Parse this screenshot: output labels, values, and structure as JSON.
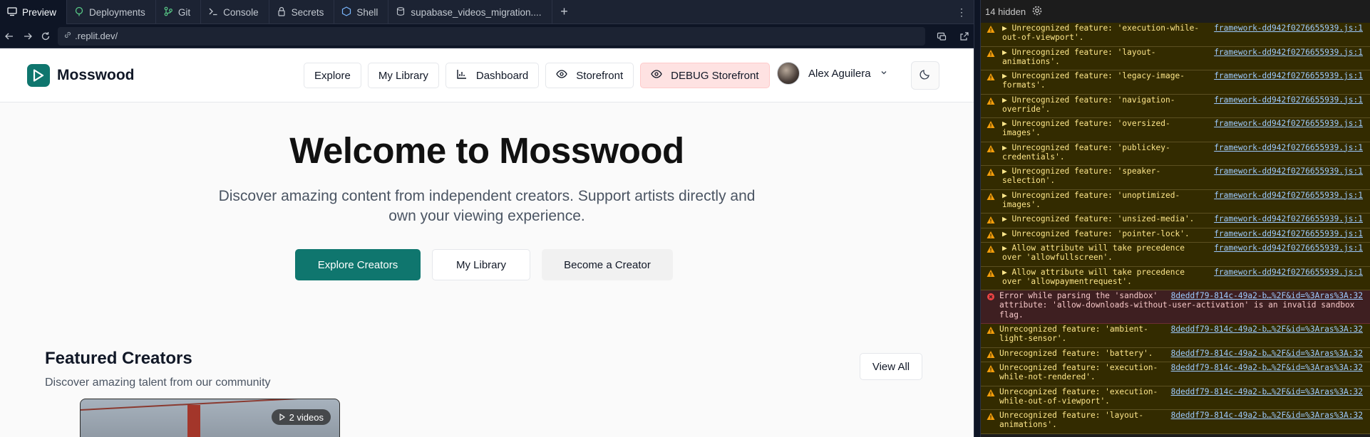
{
  "ide": {
    "tabs": [
      {
        "label": "Preview",
        "icon": "preview-icon",
        "active": true
      },
      {
        "label": "Deployments",
        "icon": "deployments-icon"
      },
      {
        "label": "Git",
        "icon": "git-icon"
      },
      {
        "label": "Console",
        "icon": "console-icon"
      },
      {
        "label": "Secrets",
        "icon": "lock-icon"
      },
      {
        "label": "Shell",
        "icon": "shell-icon"
      },
      {
        "label": "supabase_videos_migration....",
        "icon": "file-icon"
      }
    ],
    "add_tab": "+",
    "more": "⋮",
    "url": ".replit.dev/"
  },
  "site": {
    "brand": "Mosswood",
    "nav": [
      "Explore",
      "My Library",
      "Dashboard",
      "Storefront",
      "DEBUG Storefront"
    ],
    "user_name": "Alex Aguilera",
    "hero_title": "Welcome to Mosswood",
    "hero_subtitle": "Discover amazing content from independent creators. Support artists directly and own your viewing experience.",
    "cta": {
      "primary": "Explore Creators",
      "secondary": "My Library",
      "tertiary": "Become a Creator"
    },
    "featured_title": "Featured Creators",
    "featured_subtitle": "Discover amazing talent from our community",
    "view_all": "View All",
    "video_badge": "2 videos",
    "colors": {
      "accent": "#0f766e",
      "debug_bg": "#fee2e2"
    }
  },
  "console": {
    "hidden_label": "14 hidden",
    "logs": [
      {
        "type": "warn",
        "text": "▶ Unrecognized feature: 'execution-while-\nout-of-viewport'.",
        "src": "framework-dd942f0276655939.js:1",
        "size": "h2"
      },
      {
        "type": "warn",
        "text": "▶ Unrecognized feature: 'layout-\nanimations'.",
        "src": "framework-dd942f0276655939.js:1",
        "size": "h2"
      },
      {
        "type": "warn",
        "text": "▶ Unrecognized feature: 'legacy-image-\nformats'.",
        "src": "framework-dd942f0276655939.js:1",
        "size": "h2"
      },
      {
        "type": "warn",
        "text": "▶ Unrecognized feature: 'navigation-\noverride'.",
        "src": "framework-dd942f0276655939.js:1",
        "size": "h2"
      },
      {
        "type": "warn",
        "text": "▶ Unrecognized feature: 'oversized-\nimages'.",
        "src": "framework-dd942f0276655939.js:1",
        "size": "h2"
      },
      {
        "type": "warn",
        "text": "▶ Unrecognized feature: 'publickey-\ncredentials'.",
        "src": "framework-dd942f0276655939.js:1",
        "size": "h2"
      },
      {
        "type": "warn",
        "text": "▶ Unrecognized feature: 'speaker-\nselection'.",
        "src": "framework-dd942f0276655939.js:1",
        "size": "h2"
      },
      {
        "type": "warn",
        "text": "▶ Unrecognized feature: 'unoptimized-\nimages'.",
        "src": "framework-dd942f0276655939.js:1",
        "size": "h2"
      },
      {
        "type": "warn",
        "text": "▶ Unrecognized feature: 'unsized-media'.",
        "src": "framework-dd942f0276655939.js:1",
        "size": "h1"
      },
      {
        "type": "warn",
        "text": "▶ Unrecognized feature: 'pointer-lock'.",
        "src": "framework-dd942f0276655939.js:1",
        "size": "h1"
      },
      {
        "type": "warn",
        "text": "▶ Allow attribute will take precedence\nover 'allowfullscreen'.",
        "src": "framework-dd942f0276655939.js:1",
        "size": "h2"
      },
      {
        "type": "warn",
        "text": "▶ Allow attribute will take precedence\nover 'allowpaymentrequest'.",
        "src": "framework-dd942f0276655939.js:1",
        "size": "h2"
      },
      {
        "type": "error",
        "text": "Error while parsing the 'sandbox'\nattribute: 'allow-downloads-without-user-activation' is an invalid sandbox\nflag.",
        "src": "8deddf79-814c-49a2-b…%2F&id=%3Aras%3A:32",
        "size": "h3"
      },
      {
        "type": "warn",
        "text": "Unrecognized feature: 'ambient-\nlight-sensor'.",
        "src": "8deddf79-814c-49a2-b…%2F&id=%3Aras%3A:32",
        "size": "h2"
      },
      {
        "type": "warn",
        "text": "Unrecognized feature: 'battery'.",
        "src": "8deddf79-814c-49a2-b…%2F&id=%3Aras%3A:32",
        "size": "h1"
      },
      {
        "type": "warn",
        "text": "Unrecognized feature: 'execution-\nwhile-not-rendered'.",
        "src": "8deddf79-814c-49a2-b…%2F&id=%3Aras%3A:32",
        "size": "h2"
      },
      {
        "type": "warn",
        "text": "Unrecognized feature: 'execution-\nwhile-out-of-viewport'.",
        "src": "8deddf79-814c-49a2-b…%2F&id=%3Aras%3A:32",
        "size": "h2"
      },
      {
        "type": "warn",
        "text": "Unrecognized feature: 'layout-\nanimations'.",
        "src": "8deddf79-814c-49a2-b…%2F&id=%3Aras%3A:32",
        "size": "h2"
      }
    ]
  }
}
